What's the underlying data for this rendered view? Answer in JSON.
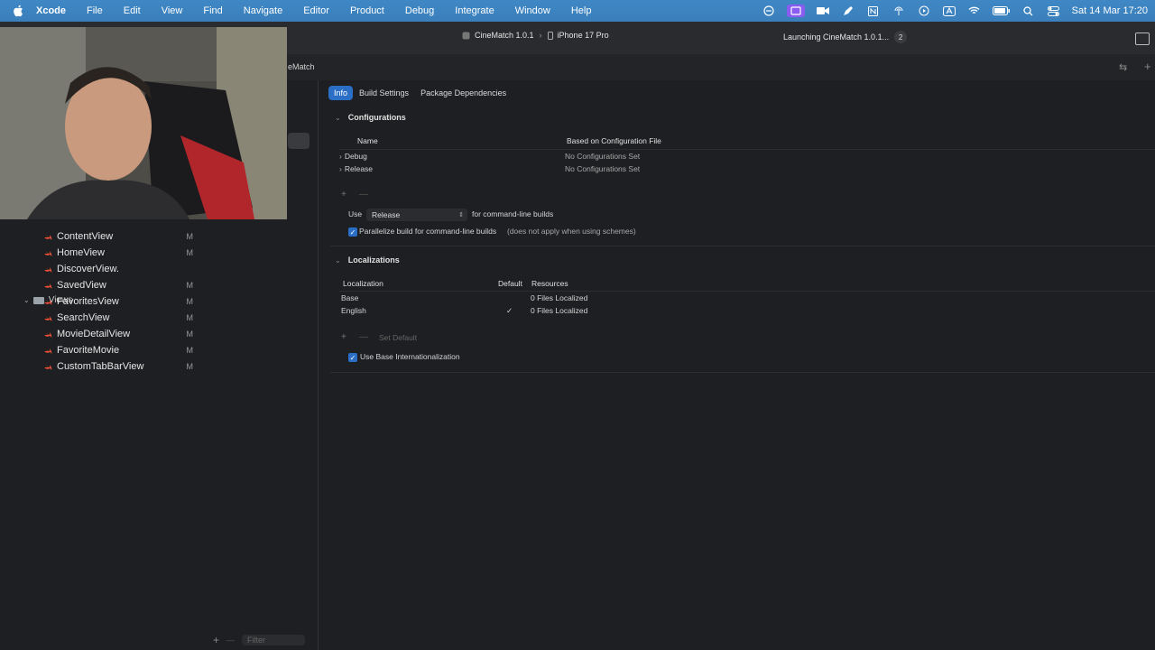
{
  "menubar": {
    "app": "Xcode",
    "items": [
      "File",
      "Edit",
      "View",
      "Find",
      "Navigate",
      "Editor",
      "Product",
      "Debug",
      "Integrate",
      "Window",
      "Help"
    ],
    "datetime": "Sat 14 Mar 17:20"
  },
  "toolbar": {
    "scheme": "CineMatch 1.0.1",
    "device": "iPhone 17 Pro",
    "activity": "Launching CineMatch 1.0.1...",
    "activity_count": "2"
  },
  "navbar": {
    "breadcrumb": "eMatch"
  },
  "sidebar": {
    "group": "Views",
    "files": [
      {
        "name": "ContentView",
        "status": "M"
      },
      {
        "name": "HomeView",
        "status": "M"
      },
      {
        "name": "DiscoverView.",
        "status": ""
      },
      {
        "name": "SavedView",
        "status": "M"
      },
      {
        "name": "FavoritesView",
        "status": "M"
      },
      {
        "name": "SearchView",
        "status": "M"
      },
      {
        "name": "MovieDetailView",
        "status": "M"
      },
      {
        "name": "FavoriteMovie",
        "status": "M"
      },
      {
        "name": "CustomTabBarView",
        "status": "M"
      }
    ]
  },
  "targets": {
    "filter_placeholder": "Filter"
  },
  "editor": {
    "tabs": [
      "Info",
      "Build Settings",
      "Package Dependencies"
    ],
    "configurations": {
      "title": "Configurations",
      "col_name": "Name",
      "col_file": "Based on Configuration File",
      "rows": [
        {
          "name": "Debug",
          "file": "No Configurations Set"
        },
        {
          "name": "Release",
          "file": "No Configurations Set"
        }
      ],
      "use_label": "Use",
      "use_value": "Release",
      "use_suffix": "for command-line builds",
      "parallelize_label": "Parallelize build for command-line builds",
      "parallelize_note": "(does not apply when using schemes)"
    },
    "localizations": {
      "title": "Localizations",
      "col_loc": "Localization",
      "col_default": "Default",
      "col_resources": "Resources",
      "rows": [
        {
          "name": "Base",
          "default": "",
          "resources": "0 Files Localized"
        },
        {
          "name": "English",
          "default": "✓",
          "resources": "0 Files Localized"
        }
      ],
      "set_default": "Set Default",
      "base_i18n_label": "Use Base Internationalization"
    }
  },
  "colors": {
    "menubar": "#3a7fbb",
    "accent": "#2a6ec6",
    "background": "#1e1f22"
  }
}
